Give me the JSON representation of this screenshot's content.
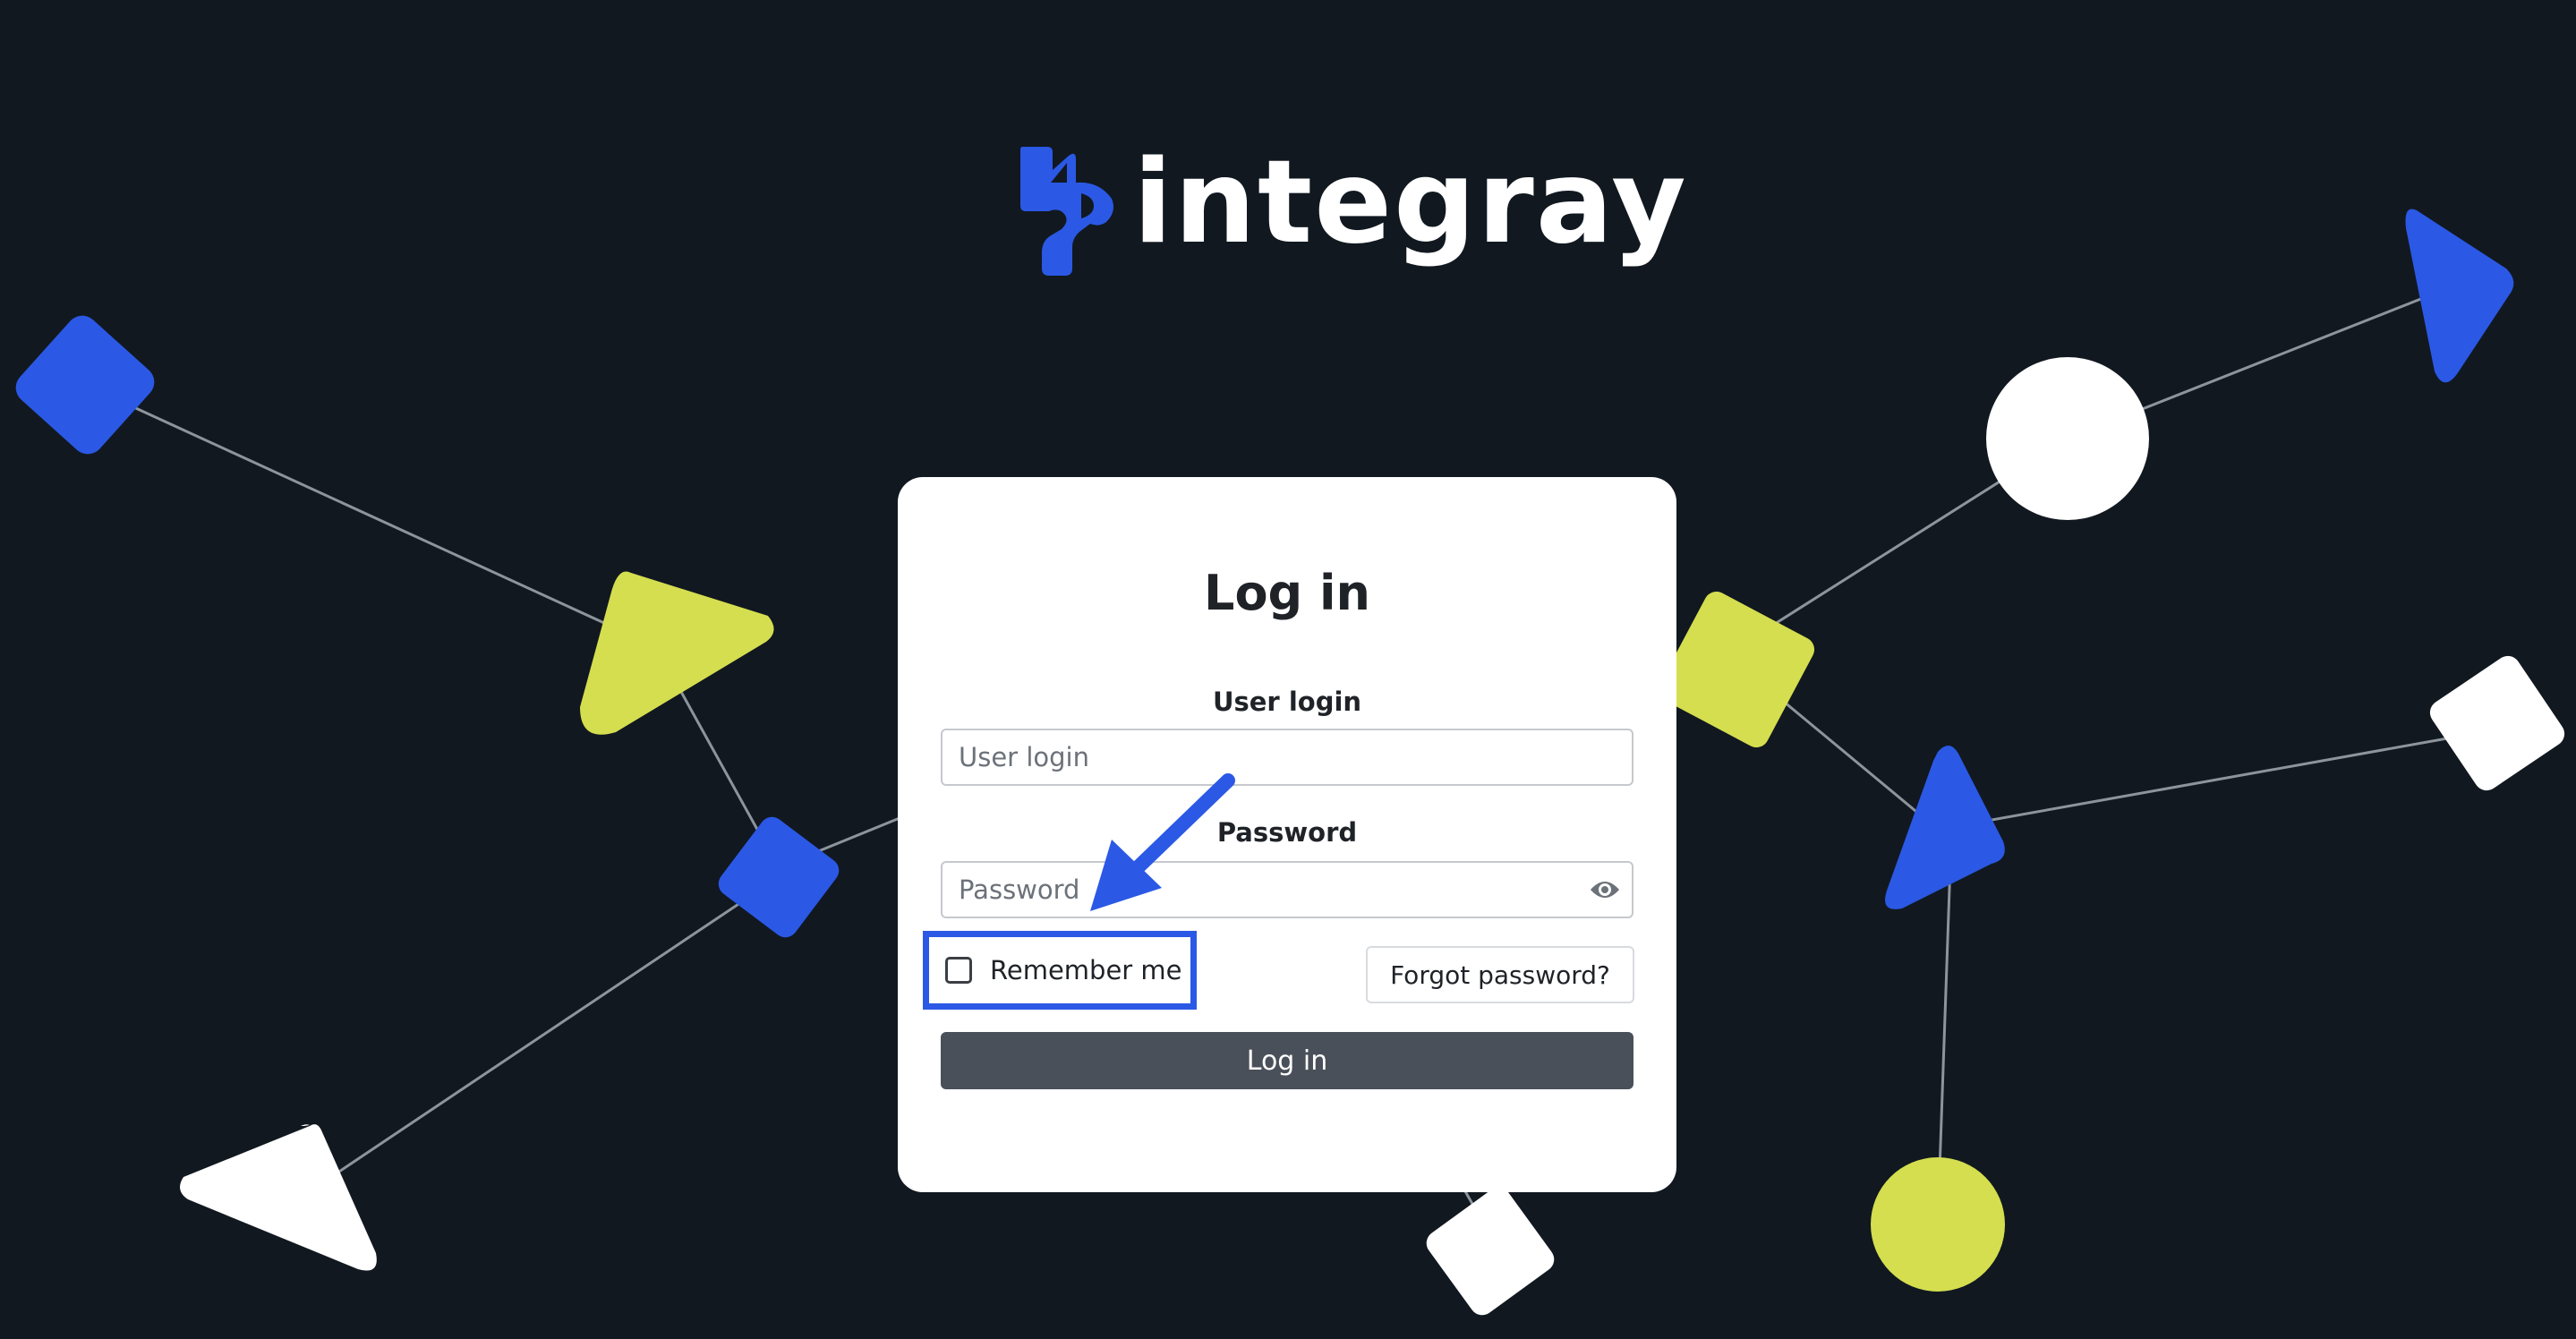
{
  "brand": {
    "name": "integray",
    "color": "#2b59e5"
  },
  "login": {
    "title": "Log in",
    "user_label": "User login",
    "user_placeholder": "User login",
    "user_value": "",
    "password_label": "Password",
    "password_placeholder": "Password",
    "password_value": "",
    "password_toggle_icon": "eye-icon",
    "remember_label": "Remember me",
    "remember_checked": false,
    "forgot_label": "Forgot password?",
    "submit_label": "Log in"
  },
  "annotation": {
    "arrow_color": "#2b59e5",
    "highlight_target": "Remember me"
  },
  "colors": {
    "background": "#111820",
    "accent_blue": "#2b59e5",
    "accent_yellow": "#d4de4f",
    "button_dark": "#4a5059"
  }
}
